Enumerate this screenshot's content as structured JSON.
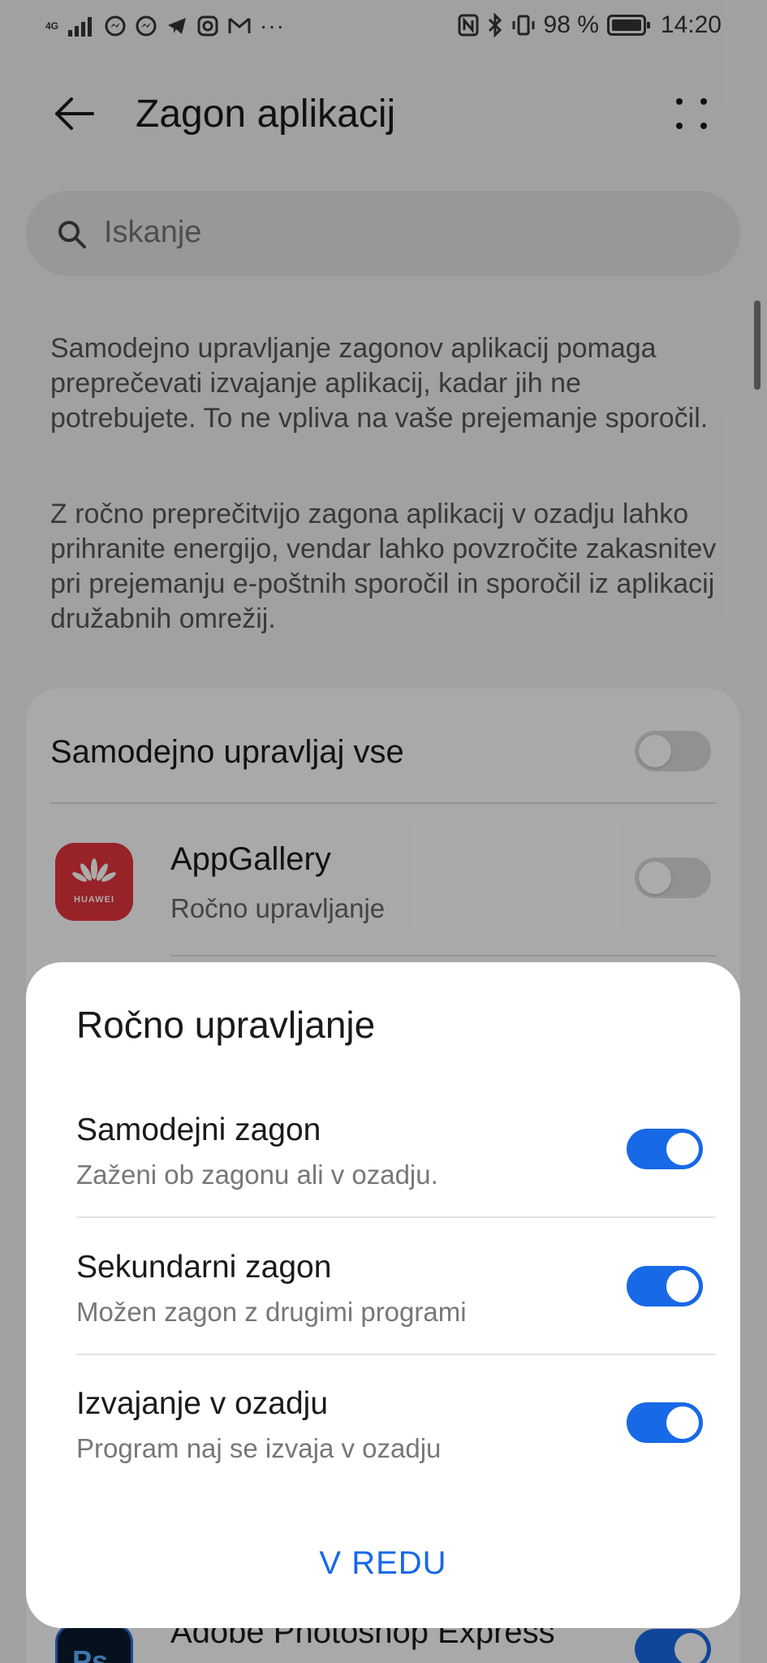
{
  "status_bar": {
    "network": "4G",
    "battery": "98 %",
    "time": "14:20",
    "icons": [
      "signal-icon",
      "messenger-icon",
      "messenger-icon",
      "telegram-icon",
      "instagram-icon",
      "gmail-icon",
      "more-dots-icon",
      "nfc-icon",
      "bluetooth-icon",
      "vibrate-icon",
      "battery-icon"
    ]
  },
  "header": {
    "title": "Zagon aplikacij"
  },
  "search": {
    "placeholder": "Iskanje"
  },
  "description": {
    "p1": "Samodejno upravljanje zagonov aplikacij pomaga preprečevati izvajanje aplikacij, kadar jih ne potrebujete. To ne vpliva na vaše prejemanje sporočil.",
    "p2": "Z ročno preprečitvijo zagona aplikacij v ozadju lahko prihranite energijo, vendar lahko povzročite zakasnitev pri prejemanju e-poštnih sporočil in sporočil iz aplikacij družabnih omrežij."
  },
  "list": {
    "auto_all_label": "Samodejno upravljaj vse",
    "auto_all_on": false,
    "apps": [
      {
        "name": "AppGallery",
        "status": "Ročno upravljanje",
        "on": false,
        "icon_brand": "HUAWEI"
      },
      {
        "name": "Adobe Photoshop Express",
        "on": true,
        "icon_label": "Ps"
      }
    ]
  },
  "dialog": {
    "title": "Ročno upravljanje",
    "options": [
      {
        "title": "Samodejni zagon",
        "subtitle": "Zaženi ob zagonu ali v ozadju.",
        "on": true
      },
      {
        "title": "Sekundarni zagon",
        "subtitle": "Možen zagon z drugimi programi",
        "on": true
      },
      {
        "title": "Izvajanje v ozadju",
        "subtitle": "Program naj se izvaja v ozadju",
        "on": true
      }
    ],
    "ok_label": "V REDU"
  },
  "colors": {
    "accent": "#1769e6",
    "scrim": "rgba(0,0,0,0.33)",
    "appgallery_red": "#e2333c"
  }
}
